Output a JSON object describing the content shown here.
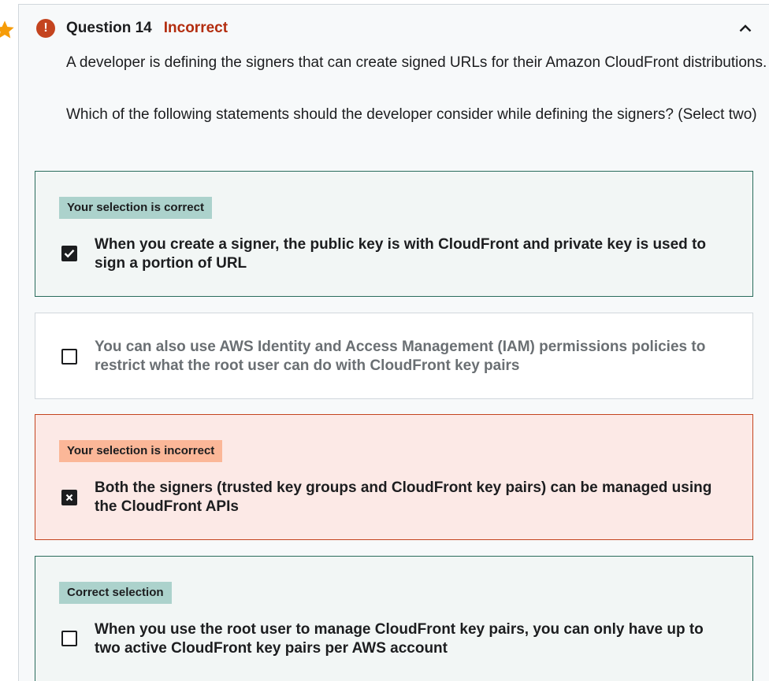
{
  "question": {
    "title": "Question 14",
    "status": "Incorrect",
    "paragraph_1": "A developer is defining the signers that can create signed URLs for their Amazon CloudFront distributions.",
    "paragraph_2": "Which of the following statements should the developer consider while defining the signers? (Select two)"
  },
  "options": [
    {
      "badge": "Your selection is correct",
      "text": "When you create a signer, the public key is with CloudFront and private key is used to sign a portion of URL",
      "checked": true
    },
    {
      "text": "You can also use AWS Identity and Access Management (IAM) permissions policies to restrict what the root user can do with CloudFront key pairs",
      "checked": false
    },
    {
      "badge": "Your selection is incorrect",
      "text": "Both the signers (trusted key groups and CloudFront key pairs) can be managed using the CloudFront APIs",
      "checked": true
    },
    {
      "badge": "Correct selection",
      "text": "When you use the root user to manage CloudFront key pairs, you can only have up to two active CloudFront key pairs per AWS account",
      "checked": false
    }
  ],
  "colors": {
    "status_incorrect": "#b32d0f",
    "correct_border": "#2a6c5c",
    "correct_badge": "#acd2cc",
    "incorrect_border": "#c4441f",
    "incorrect_badge": "#fbb798",
    "star": "#f69c08"
  },
  "icons": {
    "bookmark": "star-icon",
    "status": "exclamation-icon",
    "collapse": "chevron-up-icon"
  }
}
